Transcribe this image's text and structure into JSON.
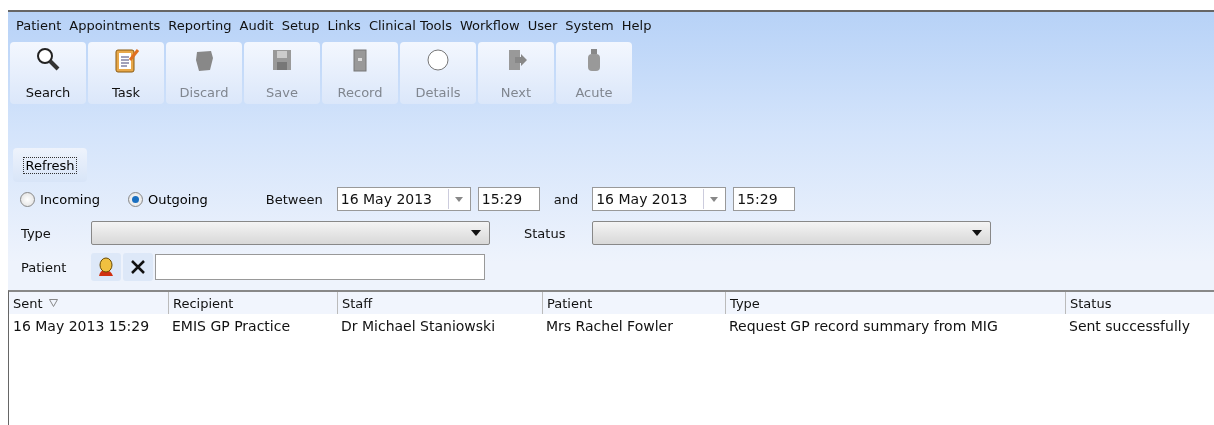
{
  "menu": [
    "Patient",
    "Appointments",
    "Reporting",
    "Audit",
    "Setup",
    "Links",
    "Clinical Tools",
    "Workflow",
    "User",
    "System",
    "Help"
  ],
  "toolbar": [
    {
      "label": "Search",
      "kind": "search",
      "disabled": false
    },
    {
      "label": "Task",
      "kind": "task",
      "disabled": false
    },
    {
      "label": "Discard",
      "kind": "discard",
      "disabled": true
    },
    {
      "label": "Save",
      "kind": "save",
      "disabled": true
    },
    {
      "label": "Record",
      "kind": "record",
      "disabled": true
    },
    {
      "label": "Details",
      "kind": "details",
      "disabled": true
    },
    {
      "label": "Next",
      "kind": "next",
      "disabled": true
    },
    {
      "label": "Acute",
      "kind": "acute",
      "disabled": true
    }
  ],
  "refresh": "Refresh",
  "direction": [
    {
      "label": "Incoming",
      "selected": false
    },
    {
      "label": "Outgoing",
      "selected": true
    }
  ],
  "between": {
    "label": "Between",
    "from_date": "16 May 2013",
    "from_time": "15:29",
    "and": "and",
    "to_date": "16 May 2013",
    "to_time": "15:29"
  },
  "type_label": "Type",
  "status_label": "Status",
  "patient_label": "Patient",
  "table": {
    "columns": [
      {
        "label": "Sent",
        "sorted": true
      },
      {
        "label": "Recipient",
        "sorted": false
      },
      {
        "label": "Staff",
        "sorted": false
      },
      {
        "label": "Patient",
        "sorted": false
      },
      {
        "label": "Type",
        "sorted": false
      },
      {
        "label": "Status",
        "sorted": false
      }
    ],
    "rows": [
      [
        "16 May 2013 15:29",
        "EMIS GP Practice",
        "Dr Michael Staniowski",
        "Mrs Rachel Fowler",
        "Request GP record summary from MIG",
        "Sent successfully"
      ]
    ]
  }
}
